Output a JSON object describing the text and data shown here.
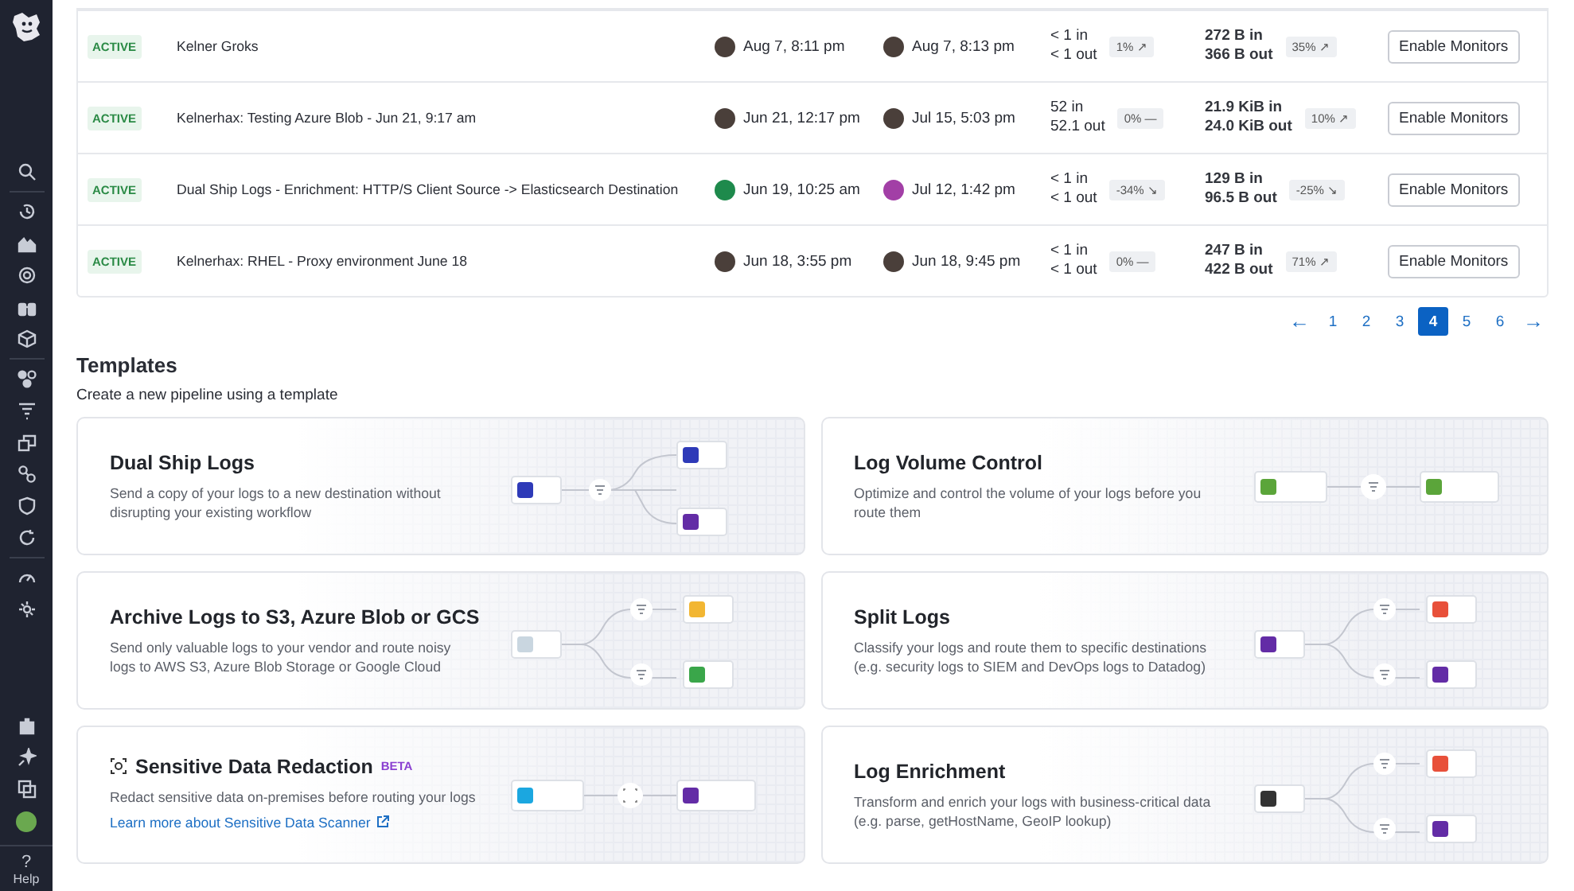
{
  "sidebar": {
    "help_glyph": "?",
    "help_label": "Help"
  },
  "pipelines": [
    {
      "status": "ACTIVE",
      "name": "Kelner Groks",
      "created": {
        "date": "Aug 7, 8:11 pm",
        "color": "#4a3f3a"
      },
      "updated": {
        "date": "Aug 7, 8:13 pm",
        "color": "#4a3f3a"
      },
      "events": {
        "in": "< 1 in",
        "out": "< 1 out",
        "change": "1% ↗"
      },
      "bytes": {
        "in": "272 B in",
        "out": "366 B out",
        "change": "35% ↗"
      },
      "action": "Enable Monitors"
    },
    {
      "status": "ACTIVE",
      "name": "Kelnerhax: Testing Azure Blob - Jun 21, 9:17 am",
      "created": {
        "date": "Jun 21, 12:17 pm",
        "color": "#4a3f3a"
      },
      "updated": {
        "date": "Jul 15, 5:03 pm",
        "color": "#4a3f3a"
      },
      "events": {
        "in": "52 in",
        "out": "52.1 out",
        "change": "0% —"
      },
      "bytes": {
        "in": "21.9 KiB in",
        "out": "24.0 KiB out",
        "change": "10% ↗"
      },
      "action": "Enable Monitors"
    },
    {
      "status": "ACTIVE",
      "name": "Dual Ship Logs - Enrichment: HTTP/S Client Source -> Elasticsearch Destination",
      "created": {
        "date": "Jun 19, 10:25 am",
        "color": "#1e8a4c"
      },
      "updated": {
        "date": "Jul 12, 1:42 pm",
        "color": "#a23fa6"
      },
      "events": {
        "in": "< 1 in",
        "out": "< 1 out",
        "change": "-34% ↘"
      },
      "bytes": {
        "in": "129 B in",
        "out": "96.5 B out",
        "change": "-25% ↘"
      },
      "action": "Enable Monitors"
    },
    {
      "status": "ACTIVE",
      "name": "Kelnerhax: RHEL - Proxy environment June 18",
      "created": {
        "date": "Jun 18, 3:55 pm",
        "color": "#4a3f3a"
      },
      "updated": {
        "date": "Jun 18, 9:45 pm",
        "color": "#4a3f3a"
      },
      "events": {
        "in": "< 1 in",
        "out": "< 1 out",
        "change": "0% —"
      },
      "bytes": {
        "in": "247 B in",
        "out": "422 B out",
        "change": "71% ↗"
      },
      "action": "Enable Monitors"
    }
  ],
  "pagination": {
    "prev": "←",
    "next": "→",
    "pages": [
      {
        "label": "1",
        "selected": false
      },
      {
        "label": "2",
        "selected": false
      },
      {
        "label": "3",
        "selected": false
      },
      {
        "label": "4",
        "selected": true
      },
      {
        "label": "5",
        "selected": false
      },
      {
        "label": "6",
        "selected": false
      }
    ]
  },
  "templates": {
    "title": "Templates",
    "subtitle": "Create a new pipeline using a template",
    "cards": [
      {
        "title": "Dual Ship Logs",
        "description": "Send a copy of your logs to a new destination without disrupting your existing workflow",
        "diagram": {
          "kind": "filter-then-split",
          "nodes": [
            {
              "color": "#2e3ab8"
            },
            {
              "color": "#2e3ab8"
            },
            {
              "color": "#632ca6"
            }
          ]
        }
      },
      {
        "title": "Log Volume Control",
        "description": "Optimize and control the volume of your logs before you route them",
        "diagram": {
          "kind": "linear-filter",
          "nodes": [
            {
              "color": "#5ba53a"
            },
            {
              "color": "#5ba53a"
            }
          ]
        }
      },
      {
        "title": "Archive Logs to S3, Azure Blob or GCS",
        "description": "Send only valuable logs to your vendor and route noisy logs to AWS S3, Azure Blob Storage or Google Cloud",
        "diagram": {
          "kind": "split-then-filter",
          "nodes": [
            {
              "color": "#c9d6e0"
            },
            {
              "color": "#f2b632"
            },
            {
              "color": "#3aa64a"
            }
          ]
        }
      },
      {
        "title": "Split Logs",
        "description": "Classify your logs and route them to specific destinations (e.g. security logs to SIEM and DevOps logs to Datadog)",
        "diagram": {
          "kind": "split-then-filter",
          "nodes": [
            {
              "color": "#632ca6"
            },
            {
              "color": "#e8503a"
            },
            {
              "color": "#632ca6"
            }
          ]
        }
      },
      {
        "title": "Sensitive Data Redaction",
        "badge": "BETA",
        "description": "Redact sensitive data on-premises before routing your logs",
        "link": "Learn more about Sensitive Data Scanner",
        "diagram": {
          "kind": "linear-scanner",
          "nodes": [
            {
              "color": "#1ba7e0"
            },
            {
              "color": "#632ca6"
            }
          ]
        }
      },
      {
        "title": "Log Enrichment",
        "description": "Transform and enrich your logs with business-critical data (e.g. parse, getHostName, GeoIP lookup)",
        "diagram": {
          "kind": "split-then-filter",
          "nodes": [
            {
              "color": "#333333"
            },
            {
              "color": "#e8503a"
            },
            {
              "color": "#632ca6"
            }
          ]
        }
      }
    ]
  }
}
